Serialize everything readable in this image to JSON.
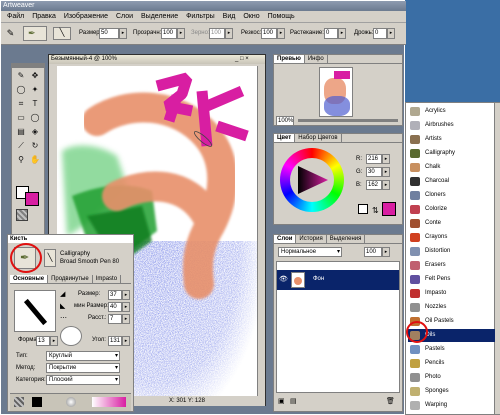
{
  "app": {
    "title": "Artweaver"
  },
  "menu": [
    "Файл",
    "Правка",
    "Изображение",
    "Слои",
    "Выделение",
    "Фильтры",
    "Вид",
    "Окно",
    "Помощь"
  ],
  "toolbar": {
    "size_label": "Размер:",
    "size_value": "50",
    "opacity_label": "Прозрачн:",
    "opacity_value": "100",
    "variance_label": "Зерно:",
    "variance_value": "100",
    "grain_label": "Резкос:",
    "grain_value": "100",
    "spread_label": "Растекание:",
    "spread_value": "0",
    "jitter_label": "Дрожь:",
    "jitter_value": "0"
  },
  "canvas": {
    "title": "Безымянный-4 @ 100%",
    "status": "X: 301  Y: 128"
  },
  "brush_panel": {
    "title": "Кисть",
    "category": "Calligraphy",
    "variant": "Broad Smooth Pen 80",
    "tabs": [
      "Основные",
      "Продвинутые",
      "Impasto"
    ],
    "size_label": "Размер:",
    "size_value": "37",
    "min_size_label": "мин Размер:",
    "min_size_value": "40",
    "spacing_label": "Расст.:",
    "spacing_value": "7",
    "form_label": "Форма:",
    "form_value": "13",
    "angle_label": "Угол:",
    "angle_value": "131",
    "type_label": "Тип:",
    "type_value": "Круглый",
    "method_label": "Метод:",
    "method_value": "Покрытие",
    "category_label": "Категория:",
    "category_value": "Плоский"
  },
  "preview_panel": {
    "tabs": [
      "Превью",
      "Инфо"
    ],
    "zoom": "100%"
  },
  "color_panel": {
    "tabs": [
      "Цвет",
      "Набор Цветов"
    ],
    "r_label": "R:",
    "r_value": "216",
    "g_label": "G:",
    "g_value": "30",
    "b_label": "B:",
    "b_value": "162",
    "current_color": "#d81ea2"
  },
  "layers_panel": {
    "tabs": [
      "Слои",
      "История",
      "Выделения"
    ],
    "blend_mode": "Нормальное",
    "opacity": "100",
    "layer_name": "Фон"
  },
  "categories": [
    {
      "label": "Acrylics",
      "color": "#b0a890"
    },
    {
      "label": "Airbrushes",
      "color": "#b0b0b8"
    },
    {
      "label": "Artists",
      "color": "#8a7050"
    },
    {
      "label": "Calligraphy",
      "color": "#5a6a30"
    },
    {
      "label": "Chalk",
      "color": "#c89060"
    },
    {
      "label": "Charcoal",
      "color": "#303030"
    },
    {
      "label": "Cloners",
      "color": "#7080a0"
    },
    {
      "label": "Colorize",
      "color": "#c04050"
    },
    {
      "label": "Conte",
      "color": "#a05030"
    },
    {
      "label": "Crayons",
      "color": "#d04020"
    },
    {
      "label": "Distortion",
      "color": "#8090b0"
    },
    {
      "label": "Erasers",
      "color": "#c06070"
    },
    {
      "label": "Felt Pens",
      "color": "#6050a0"
    },
    {
      "label": "Impasto",
      "color": "#c03030"
    },
    {
      "label": "Nozzles",
      "color": "#909090"
    },
    {
      "label": "Oil Pastels",
      "color": "#c07030"
    },
    {
      "label": "Oils",
      "color": "#a08060"
    },
    {
      "label": "Pastels",
      "color": "#7090c0"
    },
    {
      "label": "Pencils",
      "color": "#c0a040"
    },
    {
      "label": "Photo",
      "color": "#909090"
    },
    {
      "label": "Sponges",
      "color": "#c0b070"
    },
    {
      "label": "Warping",
      "color": "#b0b0b0"
    }
  ],
  "selected_category": "Oils",
  "colors": {
    "accent_red": "#e01010",
    "selection": "#0a246a"
  }
}
